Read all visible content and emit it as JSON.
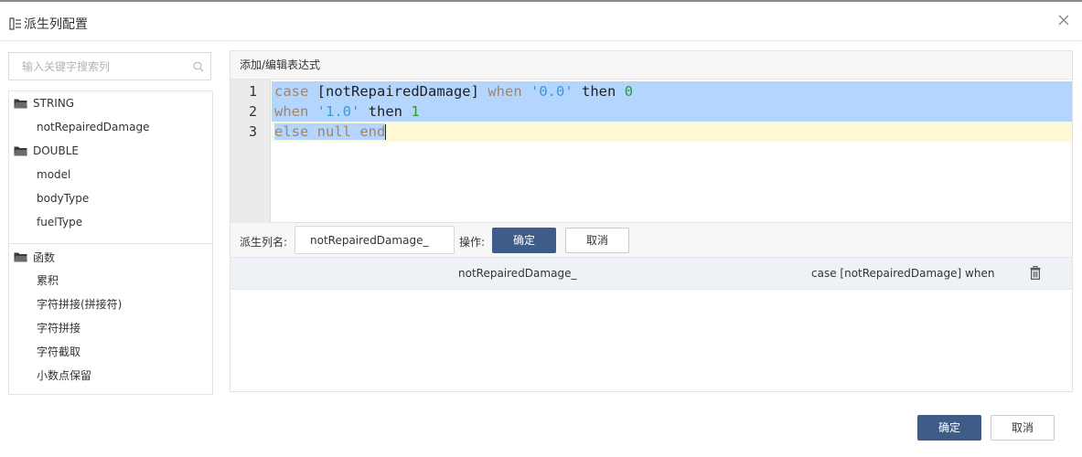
{
  "dialog": {
    "title": "派生列配置",
    "icon": "columns-icon",
    "close_icon": "close-icon"
  },
  "search": {
    "placeholder": "输入关键字搜索列",
    "icon": "search-icon",
    "value": ""
  },
  "tree": {
    "groups": [
      {
        "label": "STRING",
        "icon": "folder-icon",
        "items": [
          "notRepairedDamage"
        ]
      },
      {
        "label": "DOUBLE",
        "icon": "folder-icon",
        "items": [
          "model",
          "bodyType",
          "fuelType"
        ]
      }
    ]
  },
  "functions": {
    "label": "函数",
    "icon": "folder-icon",
    "items": [
      "累积",
      "字符拼接(拼接符)",
      "字符拼接",
      "字符截取",
      "小数点保留"
    ]
  },
  "editor": {
    "header": "添加/编辑表达式",
    "line_numbers": [
      "1",
      "2",
      "3"
    ],
    "code": {
      "l1_kw1": "case",
      "l1_col": "[notRepairedDamage]",
      "l1_kw2": "when",
      "l1_str": "'0.0'",
      "l1_then": "then",
      "l1_num": "0",
      "l2_kw1": "when",
      "l2_str": "'1.0'",
      "l2_then": "then",
      "l2_num": "1",
      "l3_kw": "else null end"
    }
  },
  "form": {
    "name_label": "派生列名:",
    "name_value": "notRepairedDamage_",
    "op_label": "操作:",
    "confirm_label": "确定",
    "cancel_label": "取消"
  },
  "results": [
    {
      "name": "notRepairedDamage_",
      "expression": "case [notRepairedDamage] when",
      "icon": "trash-icon"
    }
  ],
  "footer": {
    "confirm_label": "确定",
    "cancel_label": "取消"
  },
  "colors": {
    "primary": "#3d5c88",
    "selection": "#b4d5fe",
    "active_line": "#fef9d4",
    "keyword": "#a0856a",
    "string": "#3b9bd0",
    "number": "#2f9a2f"
  }
}
